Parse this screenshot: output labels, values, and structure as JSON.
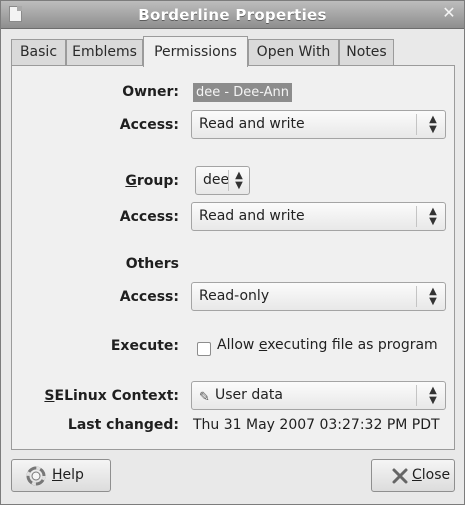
{
  "window": {
    "title": "Borderline Properties",
    "close_glyph": "✕"
  },
  "tabs": [
    {
      "label": "Basic"
    },
    {
      "label": "Emblems"
    },
    {
      "label": "Permissions"
    },
    {
      "label": "Open With"
    },
    {
      "label": "Notes"
    }
  ],
  "active_tab": "Permissions",
  "owner": {
    "label": "Owner:",
    "value": "dee - Dee-Ann",
    "access_label": "Access:",
    "access_value": "Read and write"
  },
  "group": {
    "label_mnemonic": "G",
    "label_rest": "roup:",
    "value": "dee",
    "access_label": "Access:",
    "access_value": "Read and write"
  },
  "others": {
    "heading": "Others",
    "access_label": "Access:",
    "access_value": "Read-only"
  },
  "execute": {
    "label": "Execute:",
    "checkbox_label_pre": "Allow ",
    "checkbox_label_mnemonic": "e",
    "checkbox_label_post": "xecuting file as program",
    "checked": false
  },
  "selinux": {
    "label_mnemonic": "S",
    "label_rest": "ELinux Context:",
    "icon": "selinux-context-icon",
    "value": "User data"
  },
  "last_changed": {
    "label": "Last changed:",
    "value": "Thu 31 May 2007 03:27:32 PM PDT"
  },
  "buttons": {
    "help_mnemonic": "H",
    "help_rest": "elp",
    "help_icon": "help-lifebuoy-icon",
    "close_mnemonic": "C",
    "close_rest": "lose",
    "close_icon": "close-x-icon"
  },
  "colors": {
    "titlebar": "#9e9e9e",
    "dialog_bg": "#e9e9e9",
    "panel_bg": "#f0f0f0",
    "owner_highlight": "#8c8c8c"
  }
}
